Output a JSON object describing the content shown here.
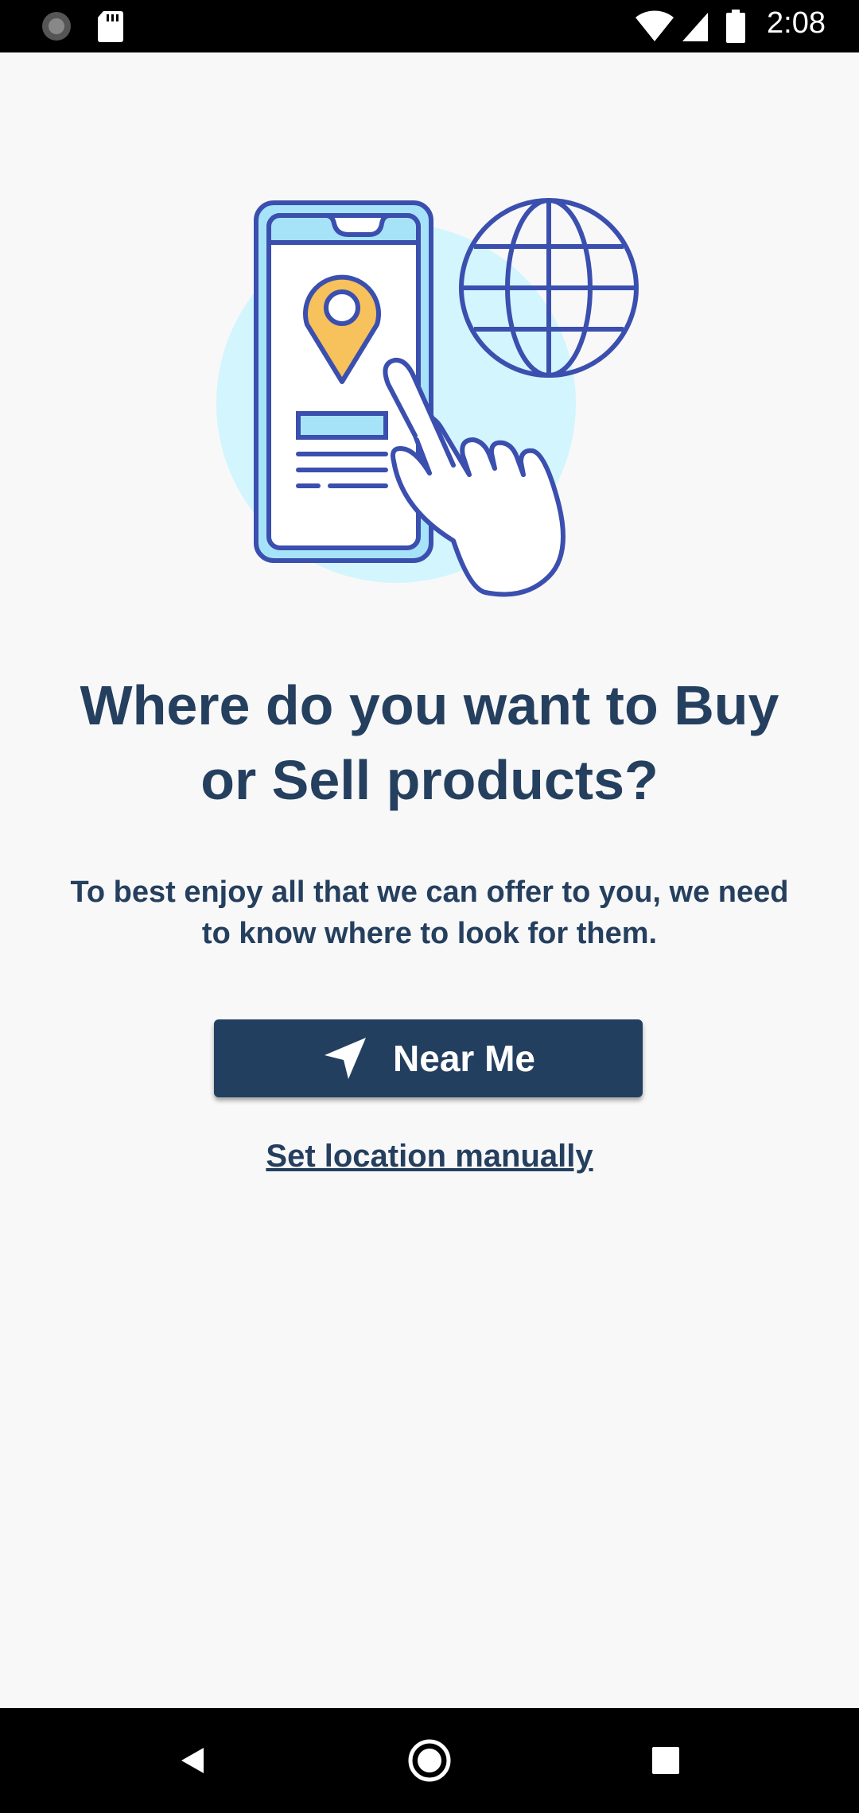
{
  "status_bar": {
    "time": "2:08",
    "icons": [
      "sync-icon",
      "sd-card-icon",
      "wifi-icon",
      "signal-icon",
      "battery-icon"
    ]
  },
  "illustration": {
    "icons": [
      "phone-location-illustration",
      "globe-icon",
      "pointing-hand-icon"
    ]
  },
  "main": {
    "title": "Where do you want to Buy or Sell products?",
    "subtitle": "To best enjoy all that we can offer to you, we need to know where to look for them.",
    "near_me_button": {
      "label": "Near Me",
      "icon": "navigation-arrow-icon"
    },
    "manual_link": "Set location manually"
  },
  "nav_bar": {
    "icons": [
      "back-icon",
      "home-icon",
      "recents-icon"
    ]
  },
  "colors": {
    "primary": "#233F5F",
    "background": "#F8F8F9",
    "accent_light": "#D3F5FD",
    "illustration_stroke": "#3B4FAF",
    "pin": "#F7C15B"
  }
}
